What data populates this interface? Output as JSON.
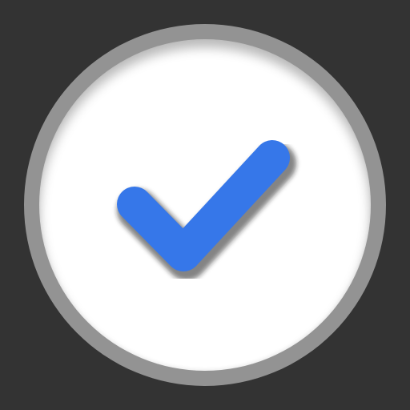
{
  "icon": {
    "name": "checkmark-circle-icon",
    "colors": {
      "background": "#333333",
      "ring": "#939393",
      "face": "#ffffff",
      "check": "#3677e9",
      "check_shadow": "#222222"
    }
  }
}
